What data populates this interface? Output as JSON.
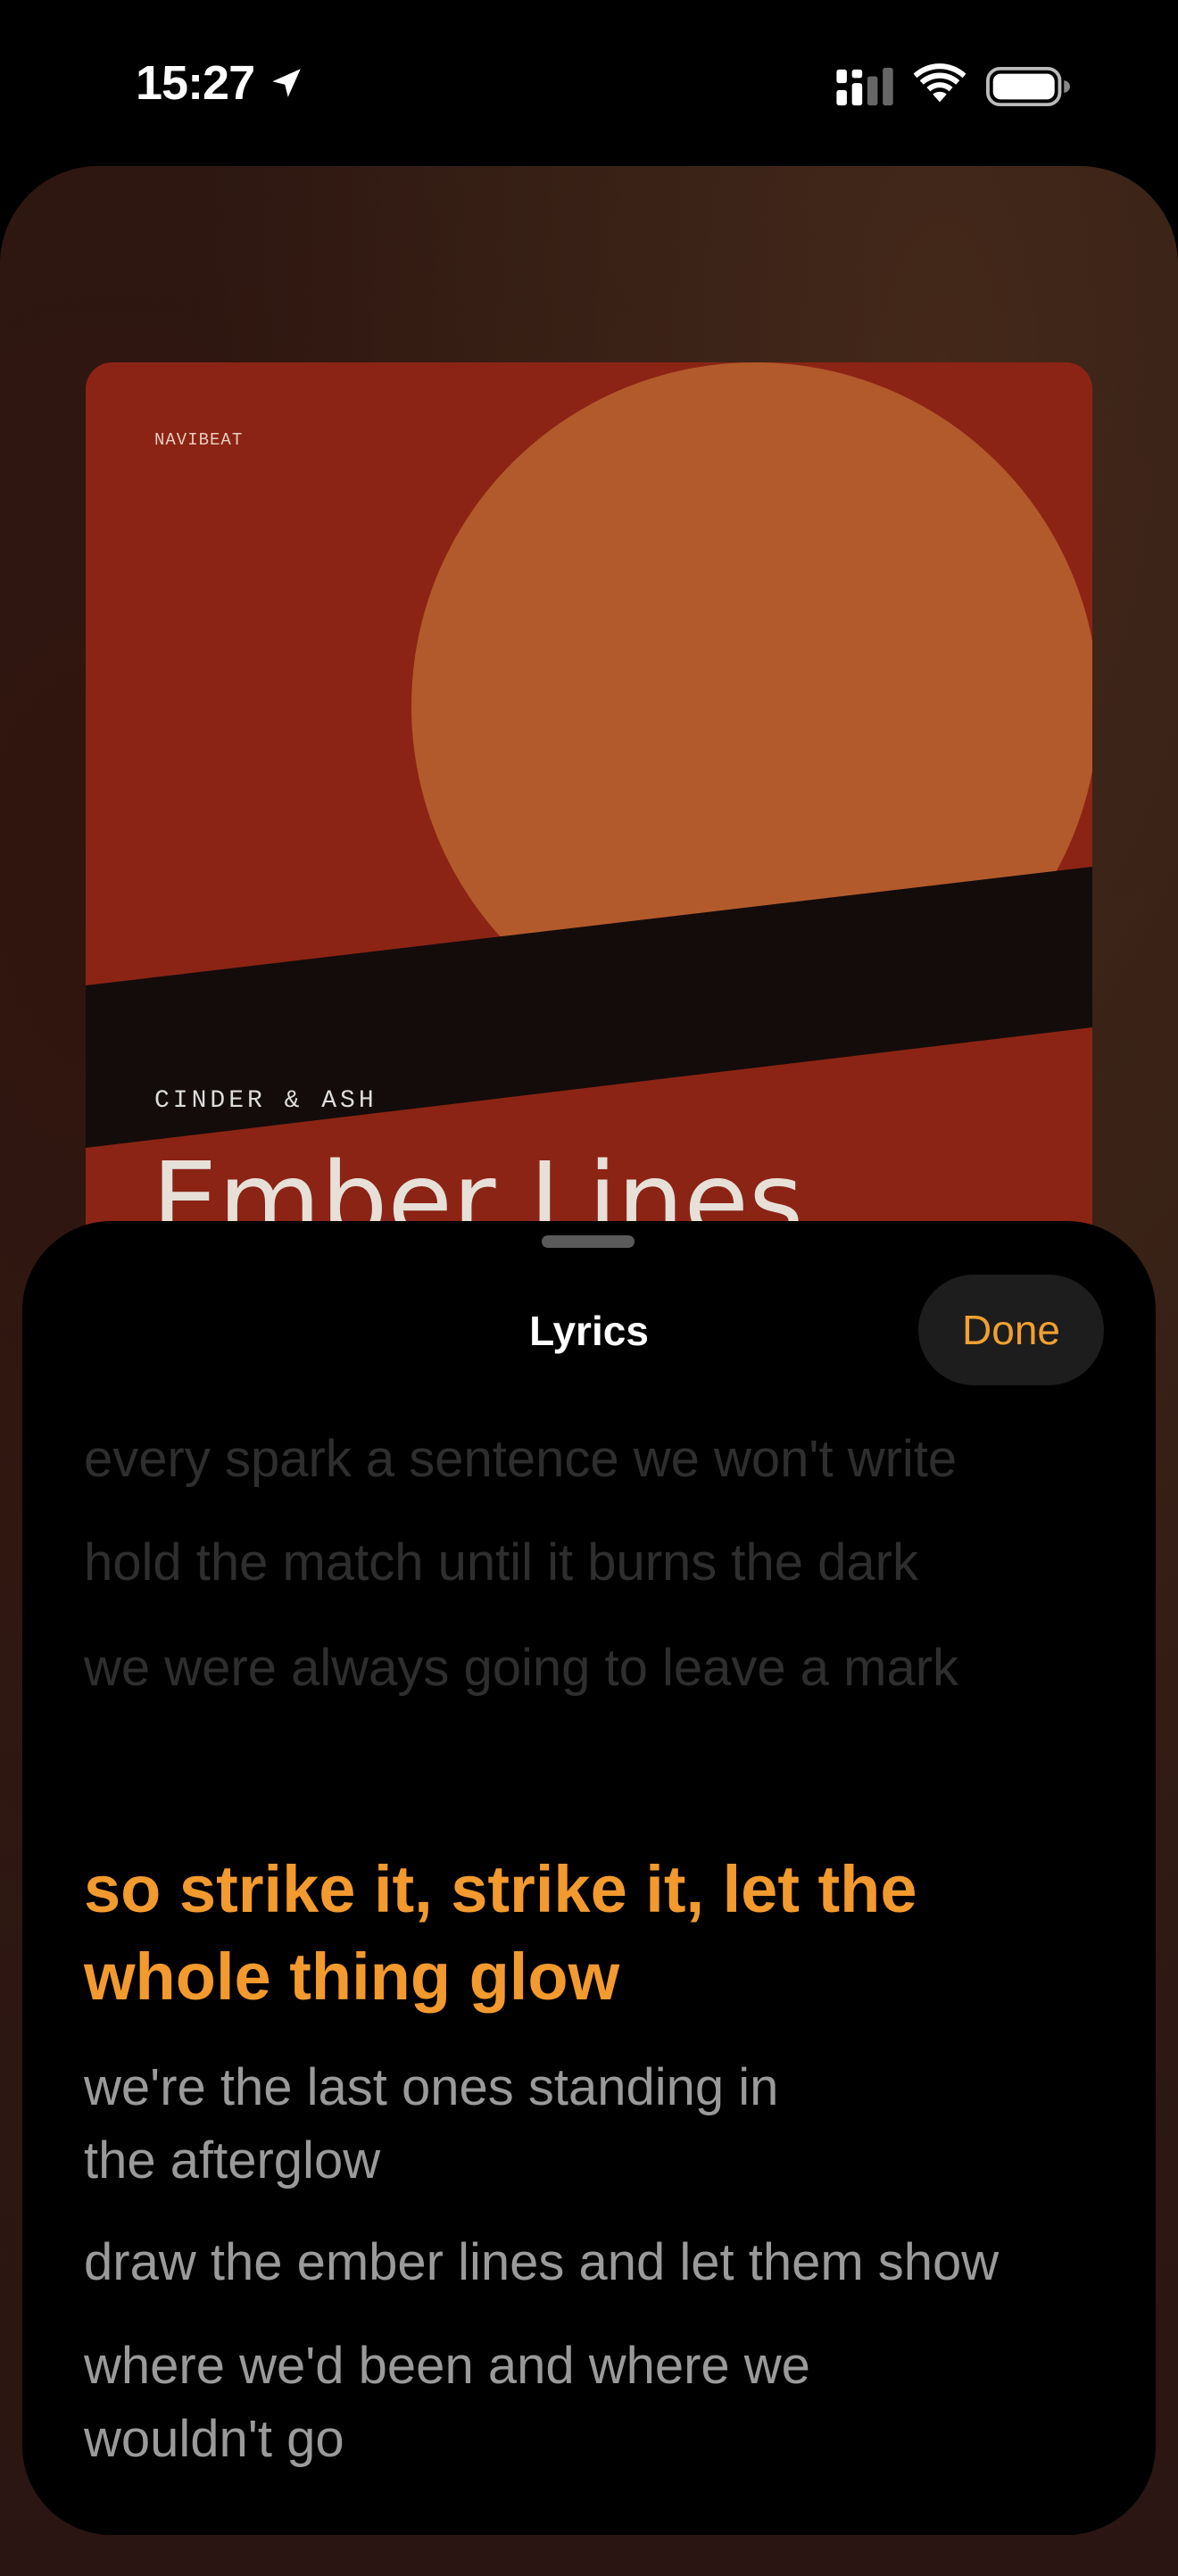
{
  "status_bar": {
    "time": "15:27",
    "icons": [
      "location-arrow-icon",
      "cellular-signal-icon",
      "wifi-icon",
      "battery-icon"
    ]
  },
  "album": {
    "label": "NAVIBEAT",
    "artist": "CINDER & ASH",
    "title": "Ember Lines",
    "colors": {
      "background": "#8b2415",
      "sun": "#b55a2b",
      "band": "#140c0a"
    }
  },
  "sheet": {
    "title": "Lyrics",
    "done_label": "Done",
    "accent": "#f29a2e"
  },
  "lyrics": {
    "past": [
      "every spark a sentence we won't write",
      "hold the match until it burns the dark",
      "we were always going to leave a mark"
    ],
    "current": [
      "so strike it, strike it, let the",
      "whole thing glow"
    ],
    "upcoming": [
      [
        "we're the last ones standing in",
        "the afterglow"
      ],
      [
        "draw the ember lines and let them show"
      ],
      [
        "where we'd been and where we",
        "wouldn't go"
      ]
    ]
  }
}
